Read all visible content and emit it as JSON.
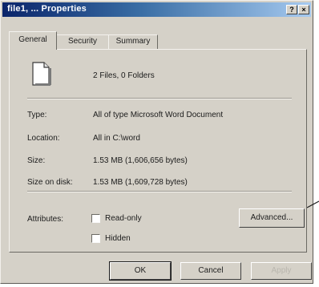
{
  "window": {
    "title": "file1, ... Properties",
    "help_button": "?",
    "close_button": "×"
  },
  "tabs": [
    {
      "label": "General",
      "active": true
    },
    {
      "label": "Security",
      "active": false
    },
    {
      "label": "Summary",
      "active": false
    }
  ],
  "general": {
    "icon": "word-document-icon",
    "file_count": "2 Files, 0 Folders",
    "properties": [
      {
        "label": "Type:",
        "value": "All of type Microsoft Word Document"
      },
      {
        "label": "Location:",
        "value": "All in C:\\word"
      },
      {
        "label": "Size:",
        "value": "1.53 MB (1,606,656 bytes)"
      },
      {
        "label": "Size on disk:",
        "value": "1.53 MB (1,609,728 bytes)"
      }
    ],
    "attributes_label": "Attributes:",
    "attributes": [
      {
        "label": "Read-only",
        "checked": false
      },
      {
        "label": "Hidden",
        "checked": false
      }
    ],
    "advanced_button": "Advanced..."
  },
  "buttons": {
    "ok": "OK",
    "cancel": "Cancel",
    "apply": "Apply"
  }
}
